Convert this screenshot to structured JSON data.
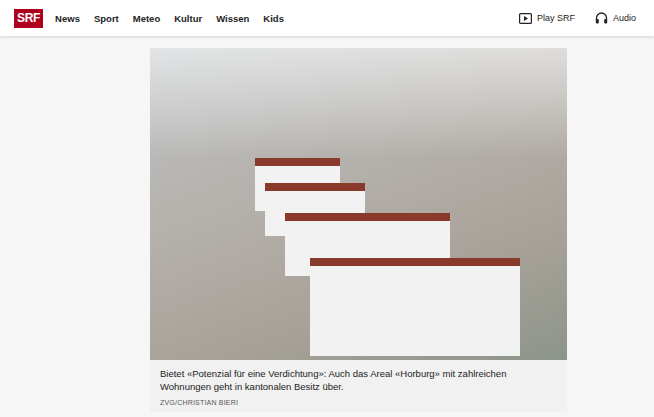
{
  "nav": {
    "logo": "SRF",
    "items": [
      {
        "label": "News"
      },
      {
        "label": "Sport"
      },
      {
        "label": "Meteo"
      },
      {
        "label": "Kultur"
      },
      {
        "label": "Wissen"
      },
      {
        "label": "Kids"
      }
    ],
    "right": [
      {
        "label": "Play SRF",
        "kind": "play"
      },
      {
        "label": "Audio",
        "kind": "audio"
      }
    ]
  },
  "figure": {
    "caption": "Bietet «Potenzial für eine Verdichtung»: Auch das Areal «Horburg» mit zahlreichen Wohnungen geht in kantonalen Besitz über.",
    "credit": "ZVG/CHRISTIAN BIERI"
  }
}
